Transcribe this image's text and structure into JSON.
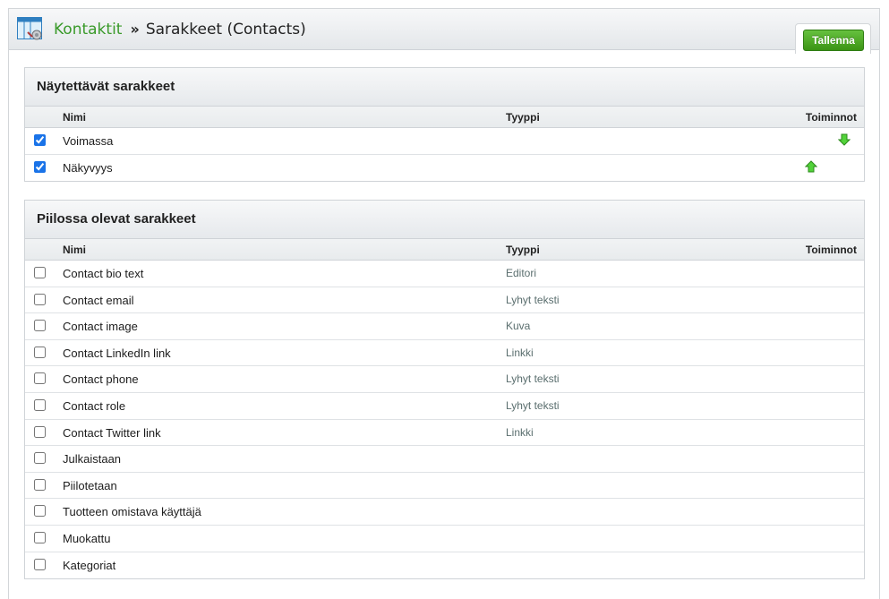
{
  "breadcrumb": {
    "parent": "Kontaktit",
    "separator": "»",
    "current": "Sarakkeet (Contacts)"
  },
  "toolbar": {
    "save_label": "Tallenna"
  },
  "colors": {
    "accent_green": "#3a9a2a",
    "button_green": "#4aa623",
    "type_text": "#5a6e6e"
  },
  "visible_columns": {
    "title": "Näytettävät sarakkeet",
    "headers": {
      "name": "Nimi",
      "type": "Tyyppi",
      "actions": "Toiminnot"
    },
    "rows": [
      {
        "name": "Voimassa",
        "type": "",
        "checked": true,
        "action_icon": "arrow-down-icon"
      },
      {
        "name": "Näkyvyys",
        "type": "",
        "checked": true,
        "action_icon": "arrow-up-icon"
      }
    ]
  },
  "hidden_columns": {
    "title": "Piilossa olevat sarakkeet",
    "headers": {
      "name": "Nimi",
      "type": "Tyyppi",
      "actions": "Toiminnot"
    },
    "rows": [
      {
        "name": "Contact bio text",
        "type": "Editori",
        "checked": false
      },
      {
        "name": "Contact email",
        "type": "Lyhyt teksti",
        "checked": false
      },
      {
        "name": "Contact image",
        "type": "Kuva",
        "checked": false
      },
      {
        "name": "Contact LinkedIn link",
        "type": "Linkki",
        "checked": false
      },
      {
        "name": "Contact phone",
        "type": "Lyhyt teksti",
        "checked": false
      },
      {
        "name": "Contact role",
        "type": "Lyhyt teksti",
        "checked": false
      },
      {
        "name": "Contact Twitter link",
        "type": "Linkki",
        "checked": false
      },
      {
        "name": "Julkaistaan",
        "type": "",
        "checked": false
      },
      {
        "name": "Piilotetaan",
        "type": "",
        "checked": false
      },
      {
        "name": "Tuotteen omistava käyttäjä",
        "type": "",
        "checked": false
      },
      {
        "name": "Muokattu",
        "type": "",
        "checked": false
      },
      {
        "name": "Kategoriat",
        "type": "",
        "checked": false
      }
    ]
  }
}
